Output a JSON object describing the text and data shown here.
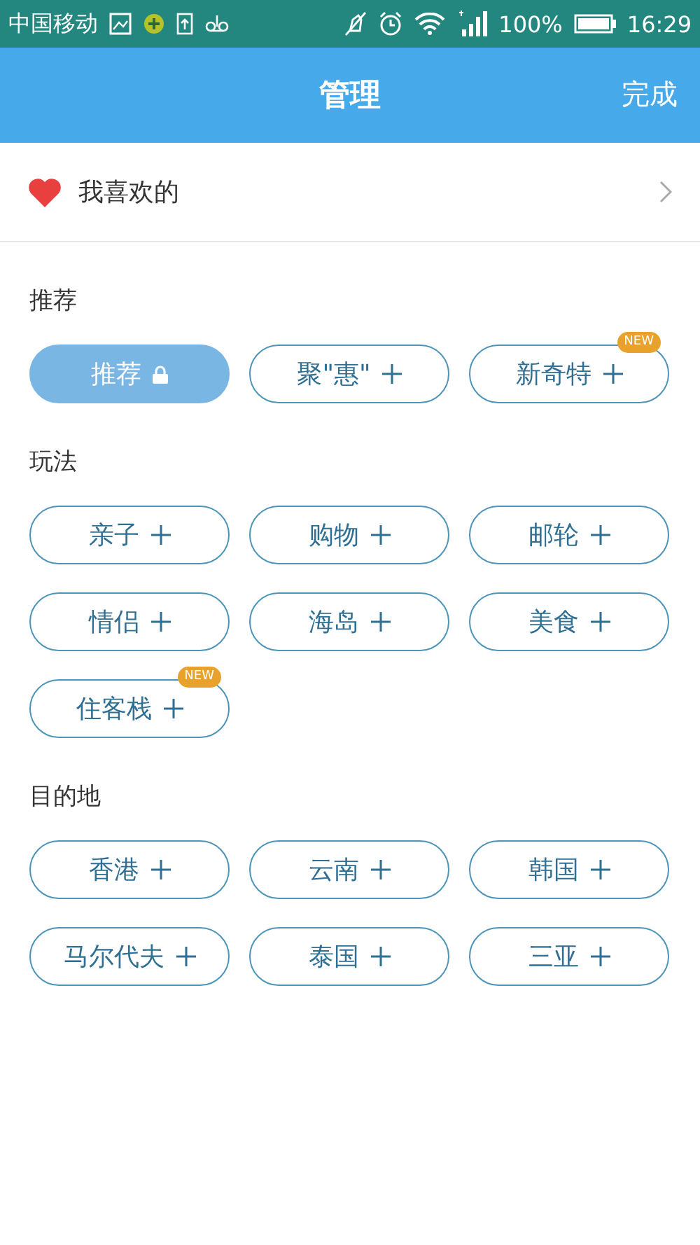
{
  "status_bar": {
    "carrier": "中国移动",
    "battery": "100%",
    "time": "16:29"
  },
  "header": {
    "title": "管理",
    "action": "完成"
  },
  "favorites": {
    "label": "我喜欢的"
  },
  "sections": [
    {
      "title": "推荐",
      "chips": [
        {
          "label": "推荐",
          "kind": "locked"
        },
        {
          "label": "聚\"惠\"",
          "kind": "add"
        },
        {
          "label": "新奇特",
          "kind": "add",
          "badge": "NEW"
        }
      ]
    },
    {
      "title": "玩法",
      "chips": [
        {
          "label": "亲子",
          "kind": "add"
        },
        {
          "label": "购物",
          "kind": "add"
        },
        {
          "label": "邮轮",
          "kind": "add"
        },
        {
          "label": "情侣",
          "kind": "add"
        },
        {
          "label": "海岛",
          "kind": "add"
        },
        {
          "label": "美食",
          "kind": "add"
        },
        {
          "label": "住客栈",
          "kind": "add",
          "badge": "NEW"
        }
      ]
    },
    {
      "title": "目的地",
      "chips": [
        {
          "label": "香港",
          "kind": "add"
        },
        {
          "label": "云南",
          "kind": "add"
        },
        {
          "label": "韩国",
          "kind": "add"
        },
        {
          "label": "马尔代夫",
          "kind": "add"
        },
        {
          "label": "泰国",
          "kind": "add"
        },
        {
          "label": "三亚",
          "kind": "add"
        }
      ]
    }
  ]
}
